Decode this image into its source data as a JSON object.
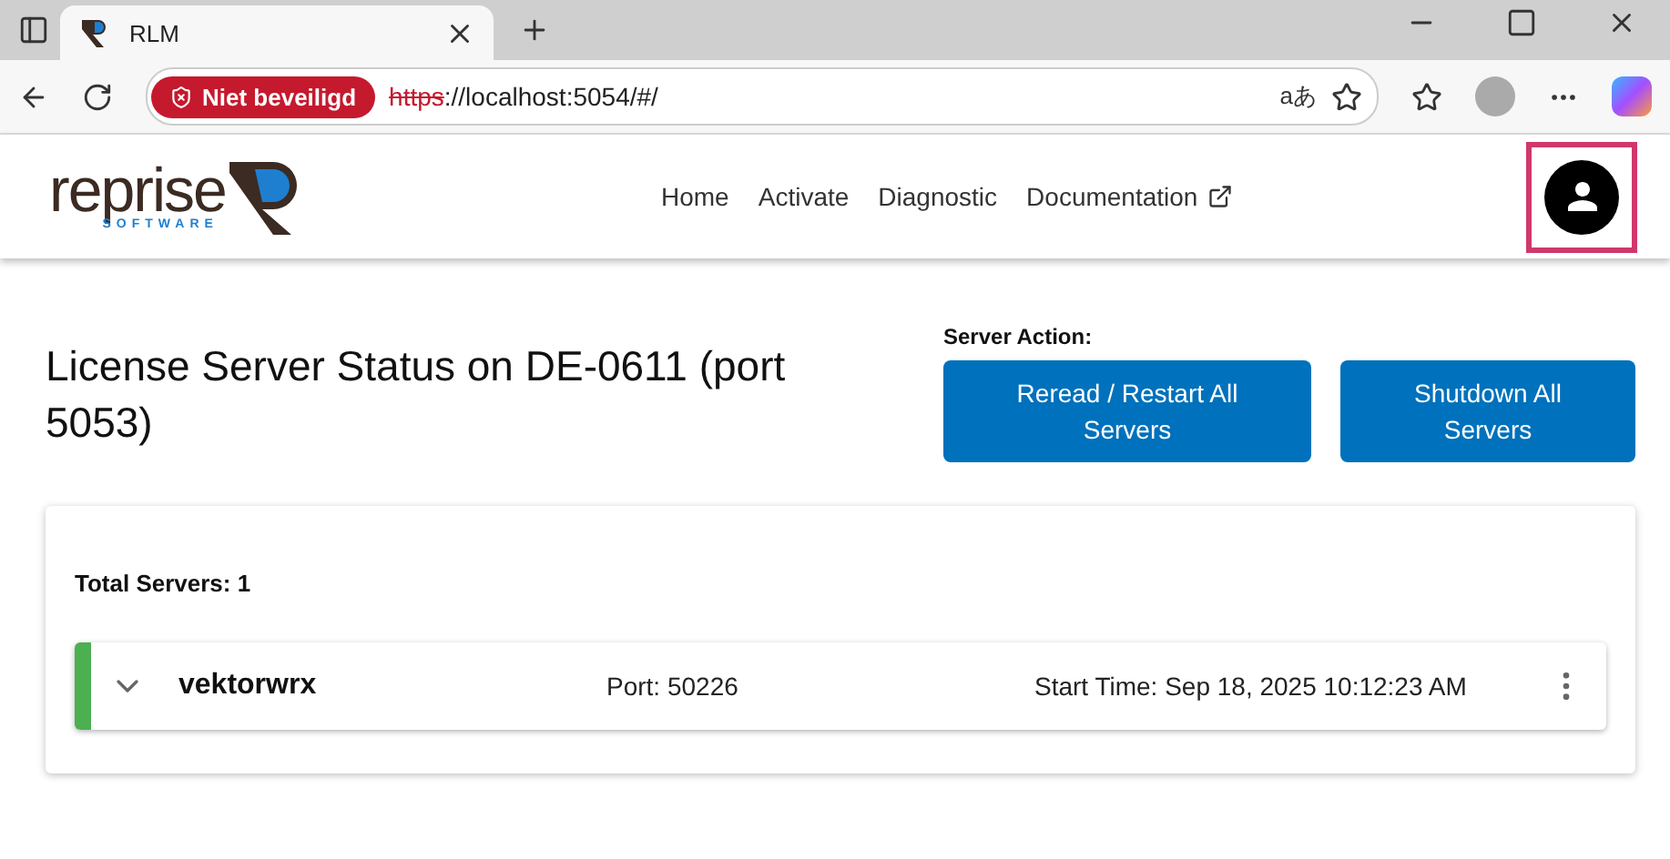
{
  "browser": {
    "tab": {
      "title": "RLM",
      "selected": true
    },
    "security_badge": "Niet beveiligd",
    "url_scheme": "https",
    "url_rest": "://localhost:5054/#/",
    "translate_glyph": "aあ"
  },
  "header": {
    "logo": {
      "word": "reprise",
      "sub": "SOFTWARE"
    },
    "nav": [
      {
        "label": "Home",
        "external": false
      },
      {
        "label": "Activate",
        "external": false
      },
      {
        "label": "Diagnostic",
        "external": false
      },
      {
        "label": "Documentation",
        "external": true
      }
    ],
    "account_highlighted": true
  },
  "title": "License Server Status on DE-0611 (port 5053)",
  "server_action": {
    "label": "Server Action:",
    "buttons": [
      "Reread / Restart All Servers",
      "Shutdown All Servers"
    ]
  },
  "total": "Total Servers: 1",
  "servers": [
    {
      "name": "vektorwrx",
      "port": "Port: 50226",
      "start": "Start Time: Sep 18, 2025 10:12:23 AM",
      "color": "#4caf50",
      "expanded": false
    }
  ]
}
